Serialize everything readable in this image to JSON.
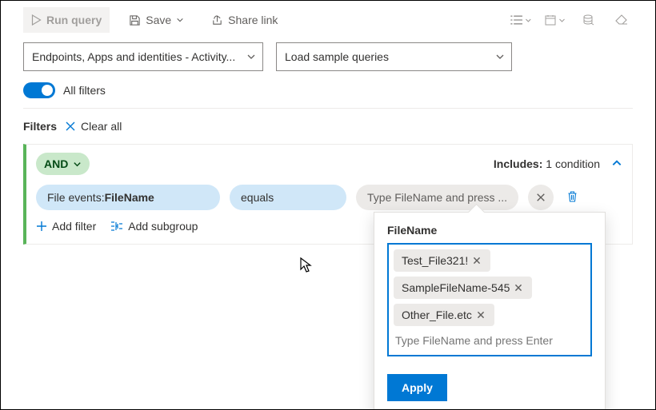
{
  "toolbar": {
    "run_label": "Run query",
    "save_label": "Save",
    "share_label": "Share link"
  },
  "dropdowns": {
    "pack_label": "Endpoints, Apps and identities - Activity...",
    "sample_label": "Load sample queries"
  },
  "all_filters_label": "All filters",
  "filtersbar": {
    "label": "Filters",
    "clear_label": "Clear all"
  },
  "card": {
    "logic_label": "AND",
    "includes_prefix": "Includes:",
    "includes_value": "1 condition",
    "field_prefix": "File events: ",
    "field_name": "FileName",
    "operator": "equals",
    "value_placeholder": "Type FileName and press ...",
    "add_filter_label": "Add filter",
    "add_subgroup_label": "Add subgroup"
  },
  "popover": {
    "title": "FileName",
    "tags": [
      "Test_File321!",
      "SampleFileName-545",
      "Other_File.etc"
    ],
    "input_placeholder": "Type FileName and press Enter",
    "apply_label": "Apply"
  }
}
